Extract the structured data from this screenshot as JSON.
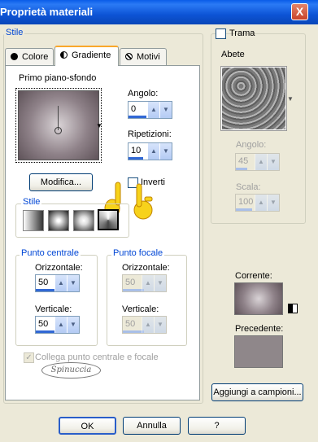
{
  "window": {
    "title": "Proprietà materiali",
    "close_glyph": "X"
  },
  "style_group": {
    "label": "Stile"
  },
  "tabs": [
    {
      "label": "Colore",
      "icon": "circle-black-icon"
    },
    {
      "label": "Gradiente",
      "icon": "half-circle-icon"
    },
    {
      "label": "Motivi",
      "icon": "pattern-icon"
    }
  ],
  "gradient": {
    "preset_label": "Primo piano-sfondo",
    "angle_label": "Angolo:",
    "angle_value": "0",
    "repeats_label": "Ripetizioni:",
    "repeats_value": "10",
    "edit_button": "Modifica...",
    "invert_label": "Inverti",
    "style_label": "Stile",
    "center_point": {
      "label": "Punto centrale",
      "h_label": "Orizzontale:",
      "h_value": "50",
      "v_label": "Verticale:",
      "v_value": "50"
    },
    "focal_point": {
      "label": "Punto focale",
      "h_label": "Orizzontale:",
      "h_value": "50",
      "v_label": "Verticale:",
      "v_value": "50"
    },
    "link_label": "Collega punto centrale e focale"
  },
  "texture": {
    "label": "Trama",
    "name": "Abete",
    "angle_label": "Angolo:",
    "angle_value": "45",
    "scale_label": "Scala:",
    "scale_value": "100"
  },
  "current_label": "Corrente:",
  "previous_label": "Precedente:",
  "add_swatch_button": "Aggiungi a campioni...",
  "watermark": "Spinuccia",
  "footer": {
    "ok": "OK",
    "cancel": "Annulla",
    "help": "?"
  },
  "colors": {
    "titlebar": "#0a5ce8",
    "dialog_bg": "#ece9d8",
    "accent": "#0046d5",
    "previous_swatch": "#8f878a"
  }
}
